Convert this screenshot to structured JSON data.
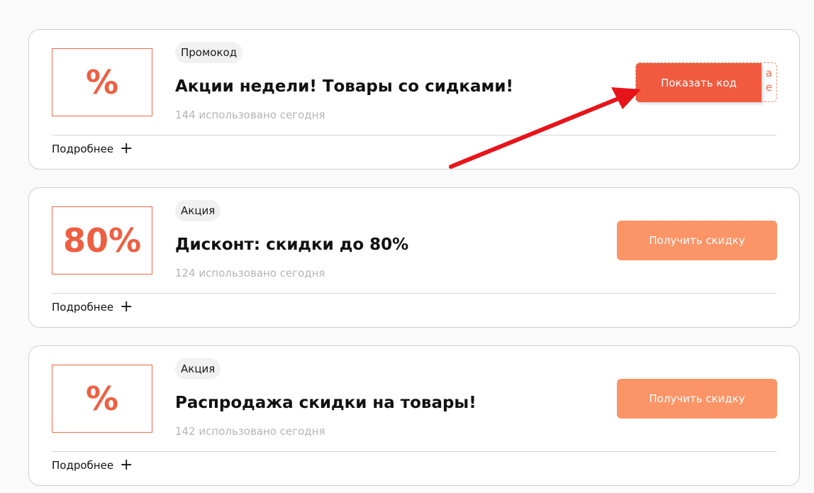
{
  "offers": [
    {
      "badge": "%",
      "tag": "Промокод",
      "title": "Акции недели! Товары со сидками!",
      "usage": "144 использовано сегодня",
      "more": "Подробнее",
      "action": "Показать код",
      "code_peek": "а\nе"
    },
    {
      "badge": "80%",
      "tag": "Акция",
      "title": "Дисконт: скидки до 80%",
      "usage": "124 использовано сегодня",
      "more": "Подробнее",
      "action": "Получить скидку"
    },
    {
      "badge": "%",
      "tag": "Акция",
      "title": "Распродажа скидки на товары!",
      "usage": "142 использовано сегодня",
      "more": "Подробнее",
      "action": "Получить скидку"
    }
  ],
  "icons": {
    "expand": "plus-icon",
    "annotation": "red-arrow"
  },
  "colors": {
    "accent": "#f05a3f",
    "button_secondary": "#fb9467",
    "badge_border": "#ee6a4c",
    "arrow": "#e8141b"
  }
}
